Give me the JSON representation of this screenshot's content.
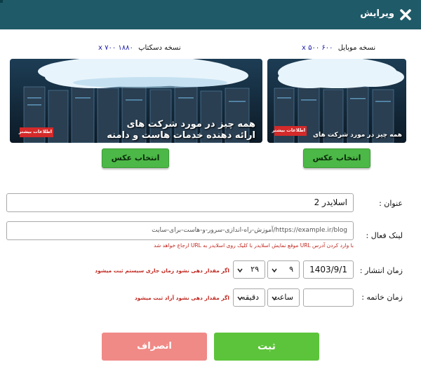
{
  "dialog": {
    "title": "ویرایش",
    "close_icon": "close-icon"
  },
  "images": {
    "mobile": {
      "label": "نسخه موبایل",
      "size": "۶۰۰ x ۵۰۰",
      "banner_heading": "همه چیز در مورد شرکت های",
      "banner_button": "اطلاعات بیشتر",
      "pick_button": "انتخاب عکس"
    },
    "desktop": {
      "label": "نسخه دسکتاپ",
      "size": "۱۸۸۰ x ۷۰۰",
      "banner_heading": "همه چیز در مورد شرکت های",
      "banner_sub": "ارائه دهنده خدمات هاست و دامنه",
      "banner_button": "اطلاعات بیشتر",
      "pick_button": "انتخاب عکس"
    }
  },
  "form": {
    "title_label": "عنوان :",
    "title_value": "اسلایدر 2",
    "link_label": "لینک فعال :",
    "link_value": "https://example.ir/blog/آموزش-راه-اندازی-سرور-و-هاست-برای-سایت",
    "link_hint": "با وارد کردن آدرس URL موقع نمایش اسلایدر با کلیک روی اسلایدر به URL ارجاع خواهد شد",
    "publish_label": "زمان انتشار :",
    "publish_date": "1403/9/1",
    "publish_hour": "۹",
    "publish_minute": "۲۹",
    "publish_hint": "اگر مقدار دهی نشود زمان جاری سیستم ثبت میشود",
    "expire_label": "زمان خاتمه :",
    "expire_date": "",
    "expire_hour": "ساعت",
    "expire_minute": "دقیقه",
    "expire_hint": "اگر مقدار دهی نشود آزاد ثبت میشود"
  },
  "actions": {
    "submit": "ثبت",
    "cancel": "انصراف"
  },
  "colors": {
    "header": "#1f5a68",
    "pick_button": "#4cb847",
    "submit": "#5cc43a",
    "cancel": "#f08a86",
    "hint": "#c0271f",
    "size_text": "#1a1aa8"
  }
}
